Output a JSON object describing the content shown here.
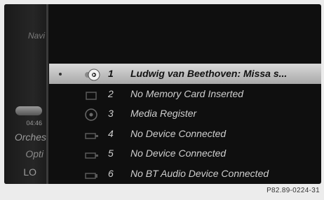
{
  "sidebar": {
    "navi_label": "Navi",
    "time": "04:46",
    "orchestra_label": "Orches",
    "options_label": "Opti",
    "lo_label": "LO"
  },
  "media_list": [
    {
      "num": "1",
      "label": "Ludwig van Beethoven: Missa s...",
      "icon": "audio-disc-icon",
      "selected": true
    },
    {
      "num": "2",
      "label": "No Memory Card Inserted",
      "icon": "memory-card-icon",
      "selected": false
    },
    {
      "num": "3",
      "label": "Media Register",
      "icon": "media-register-icon",
      "selected": false
    },
    {
      "num": "4",
      "label": "No Device Connected",
      "icon": "usb-device-icon",
      "selected": false
    },
    {
      "num": "5",
      "label": "No Device Connected",
      "icon": "usb-device-icon",
      "selected": false
    },
    {
      "num": "6",
      "label": "No BT Audio Device Connected",
      "icon": "bluetooth-audio-icon",
      "selected": false
    }
  ],
  "footer_code": "P82.89-0224-31"
}
